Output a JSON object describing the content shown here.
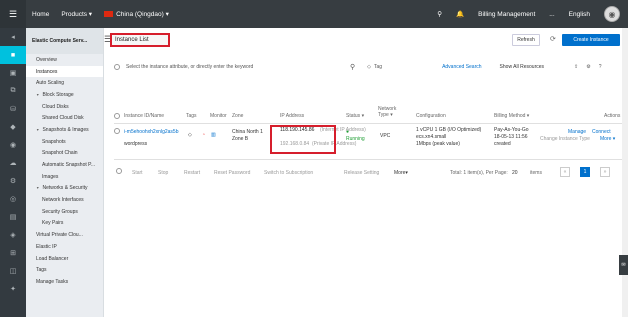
{
  "topbar": {
    "home": "Home",
    "products": "Products ▾",
    "region": "China (Qingdao) ▾",
    "billing": "Billing Management",
    "more": "...",
    "language": "English"
  },
  "sidebar": {
    "header": "Elastic Compute Serv...",
    "items": [
      "Overview",
      "Instances",
      "Auto Scaling",
      "Block Storage",
      "Cloud Disks",
      "Shared Cloud Disk",
      "Snapshots & Images",
      "Snapshots",
      "Snapshot Chain",
      "Automatic Snapshot P...",
      "Images",
      "Networks & Security",
      "Network Interfaces",
      "Security Groups",
      "Key Pairs",
      "Virtual Private Clou...",
      "Elastic IP",
      "Load Balancer",
      "Tags",
      "Manage Tasks"
    ]
  },
  "main": {
    "title": "Instance List",
    "refresh": "Refresh",
    "create": "Create Instance",
    "search_placeholder": "Select the instance attribute, or directly enter the keyword",
    "tag": "Tag",
    "advanced": "Advanced Search",
    "show_all": "Show All Resources",
    "columns": [
      "Instance ID/Name",
      "Tags",
      "Monitor",
      "Zone",
      "IP Address",
      "Status ▾",
      "Network Type ▾",
      "Configuration",
      "Billing Method ▾",
      "Actions"
    ],
    "row": {
      "id": "i-m5ehoohxh2xnlg2as5b",
      "name": "wordpress",
      "zone1": "China North 1",
      "zone2": "Zone B",
      "ip_public": "118.190.145.86",
      "ip_public_label": "(Internet IP Address)",
      "ip_private": "192.168.0.84",
      "ip_private_label": "(Private IP Address)",
      "status": "Running",
      "network": "VPC",
      "config1": "1 vCPU 1 GB (I/O Optimized)",
      "config2": "ecs.xn4.small",
      "config3": "1Mbps (peak value)",
      "billing1": "Pay-As-You-Go",
      "billing2": "18-05-13 11:56",
      "billing3": "created",
      "action_manage": "Manage",
      "action_connect": "Connect",
      "action_change": "Change Instance Type",
      "action_more": "More ▾"
    },
    "bulk": [
      "Start",
      "Stop",
      "Restart",
      "Reset Password",
      "Switch to Subscription",
      "Release Setting",
      "More▾"
    ],
    "pager": {
      "total": "Total: 1 item(s), Per Page:",
      "per_page": "20",
      "items": "items",
      "prev": "«",
      "page": "1",
      "next": "»"
    }
  },
  "colors": {
    "accent": "#0070cc",
    "highlight": "#d61e2c",
    "topbar": "#373d41"
  }
}
